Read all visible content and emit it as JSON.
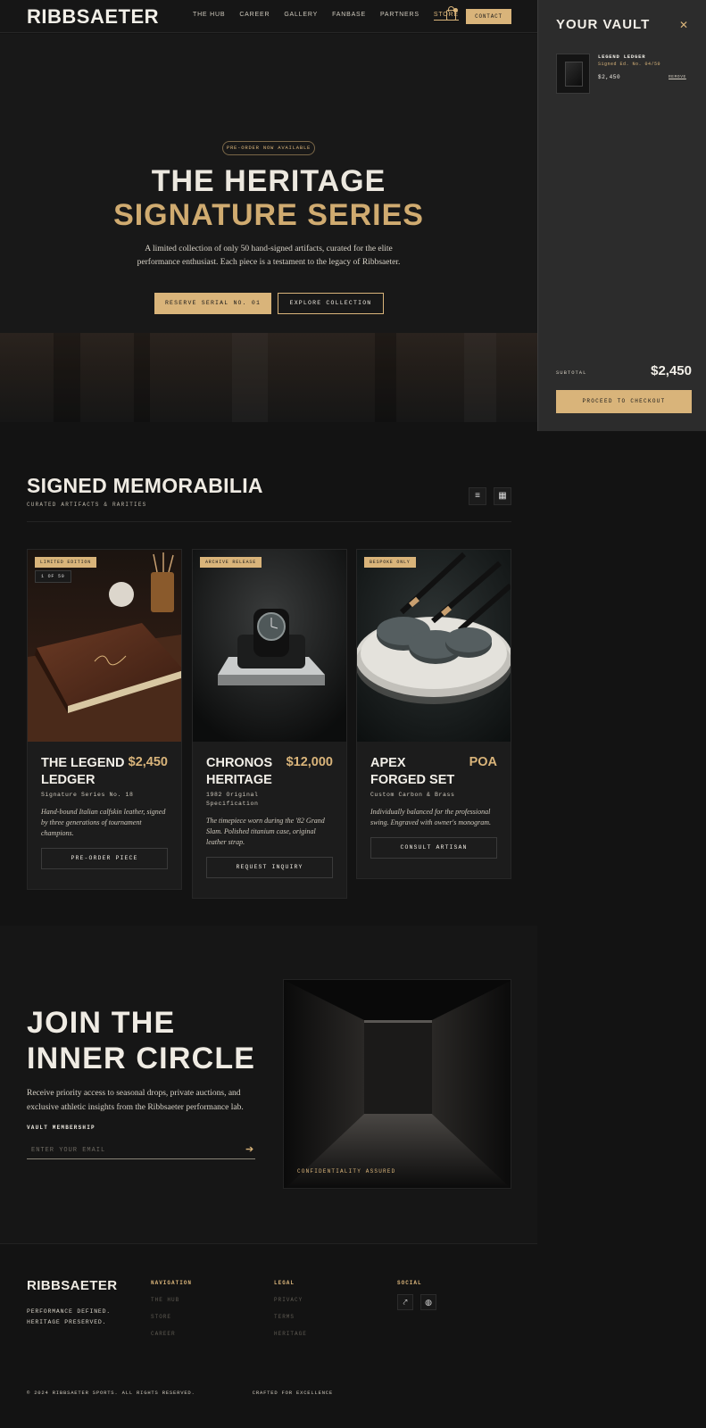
{
  "nav": {
    "brand": "RIBBSAETER",
    "links": [
      "THE HUB",
      "CAREER",
      "GALLERY",
      "FANBASE",
      "PARTNERS",
      "STORE"
    ],
    "active": "STORE",
    "contact": "CONTACT",
    "cart_icon": "shopping-bag-icon"
  },
  "hero": {
    "pill": "PRE-ORDER NOW AVAILABLE",
    "title_line1": "THE HERITAGE",
    "title_line2": "SIGNATURE SERIES",
    "description": "A limited collection of only 50 hand-signed artifacts, curated for the elite performance enthusiast. Each piece is a testament to the legacy of Ribbsaeter.",
    "primary_button": "RESERVE SERIAL NO. 01",
    "secondary_button": "EXPLORE COLLECTION"
  },
  "memorabilia": {
    "title": "SIGNED MEMORABILIA",
    "subtitle": "CURATED ARTIFACTS & RARITIES",
    "filter_icon": "filter-icon",
    "grid_icon": "grid-view-icon",
    "cards": [
      {
        "badge": "LIMITED EDITION",
        "badge2": "1 OF 50",
        "name": "THE LEGEND LEDGER",
        "price": "$2,450",
        "spec": "Signature Series No. 18",
        "desc": "Hand-bound Italian calfskin leather, signed by three generations of tournament champions.",
        "button": "PRE-ORDER PIECE"
      },
      {
        "badge": "ARCHIVE RELEASE",
        "badge2": "",
        "name": "CHRONOS HERITAGE",
        "price": "$12,000",
        "spec": "1982 Original Specification",
        "desc": "The timepiece worn during the '82 Grand Slam. Polished titanium case, original leather strap.",
        "button": "REQUEST INQUIRY"
      },
      {
        "badge": "BESPOKE ONLY",
        "badge2": "",
        "name": "APEX FORGED SET",
        "price": "POA",
        "spec": "Custom Carbon & Brass",
        "desc": "Individually balanced for the professional swing. Engraved with owner's monogram.",
        "button": "CONSULT ARTISAN"
      }
    ]
  },
  "inner_circle": {
    "title_line1": "JOIN THE",
    "title_line2": "INNER CIRCLE",
    "description": "Receive priority access to seasonal drops, private auctions, and exclusive athletic insights from the Ribbsaeter performance lab.",
    "label": "VAULT MEMBERSHIP",
    "placeholder": "ENTER YOUR EMAIL",
    "image_caption": "CONFIDENTIALITY ASSURED"
  },
  "footer": {
    "brand": "RIBBSAETER",
    "tagline": "PERFORMANCE DEFINED.\nHERITAGE PRESERVED.",
    "navigation": {
      "heading": "NAVIGATION",
      "items": [
        "THE HUB",
        "STORE",
        "CAREER"
      ]
    },
    "legal": {
      "heading": "LEGAL",
      "items": [
        "PRIVACY",
        "TERMS",
        "HERITAGE"
      ]
    },
    "social": {
      "heading": "SOCIAL",
      "icons": [
        "share-icon",
        "globe-icon"
      ]
    },
    "copyright": "© 2024 RIBBSAETER SPORTS. ALL RIGHTS RESERVED.",
    "crafted": "CRAFTED FOR EXCELLENCE"
  },
  "vault": {
    "title": "YOUR VAULT",
    "item_name": "LEGEND LEDGER",
    "item_sub": "Signed Ed. No. 04/50",
    "item_price": "$2,450",
    "remove": "REMOVE",
    "subtotal_label": "SUBTOTAL",
    "subtotal_value": "$2,450",
    "checkout": "PROCEED TO CHECKOUT"
  },
  "colors": {
    "accent": "#d9b47a",
    "background": "#131313",
    "panel": "#2c2c2c"
  }
}
